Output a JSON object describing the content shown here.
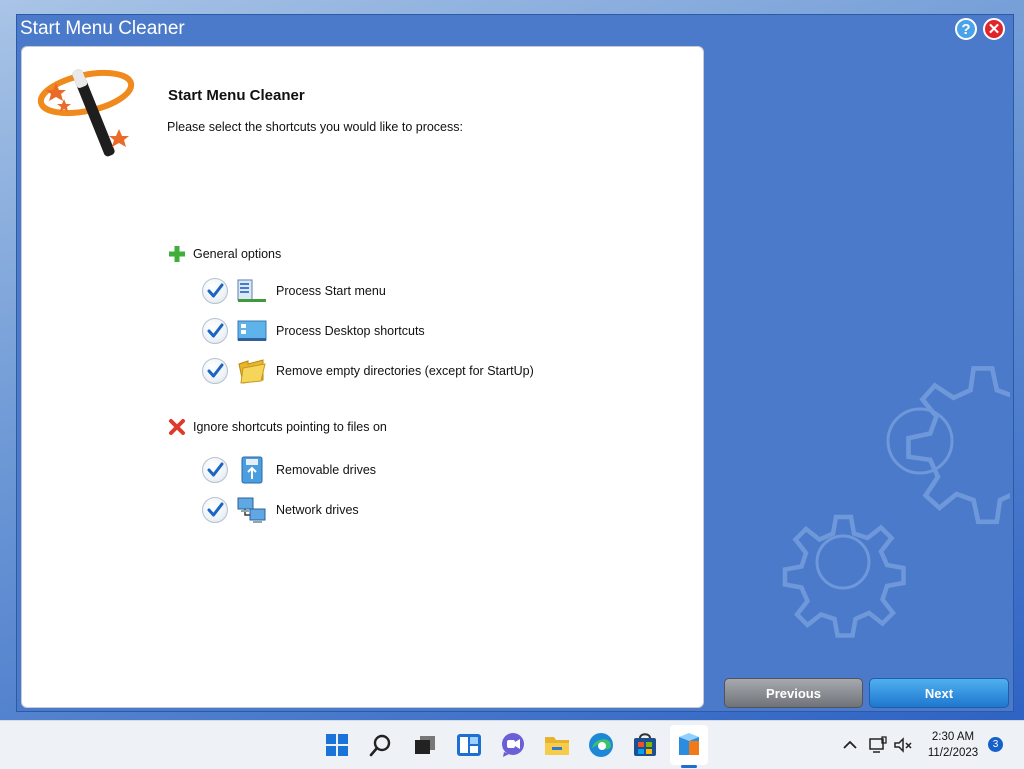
{
  "window": {
    "title": "Start Menu Cleaner",
    "help_label": "?",
    "close_label": "✕"
  },
  "panel": {
    "heading": "Start Menu Cleaner",
    "subtitle": "Please select the shortcuts you would like to process:"
  },
  "general": {
    "label": "General options",
    "icon": "plus-icon",
    "options": [
      {
        "label": "Process Start menu",
        "checked": true,
        "icon": "start-menu-icon"
      },
      {
        "label": "Process Desktop shortcuts",
        "checked": true,
        "icon": "desktop-icon"
      },
      {
        "label": "Remove empty directories (except for StartUp)",
        "checked": true,
        "icon": "folder-icon"
      }
    ]
  },
  "ignore": {
    "label": "Ignore shortcuts pointing to files on",
    "icon": "x-icon",
    "options": [
      {
        "label": "Removable drives",
        "checked": true,
        "icon": "usb-drive-icon"
      },
      {
        "label": "Network drives",
        "checked": true,
        "icon": "network-drives-icon"
      }
    ]
  },
  "buttons": {
    "previous": "Previous",
    "next": "Next"
  },
  "taskbar": {
    "time": "2:30 AM",
    "date": "11/2/2023",
    "notification_count": "3",
    "icons": [
      "windows-start-icon",
      "search-icon",
      "task-view-icon",
      "widgets-icon",
      "chat-icon",
      "file-explorer-icon",
      "edge-icon",
      "store-icon",
      "app-cleaner-icon"
    ]
  },
  "colors": {
    "window_bg": "#4a7ac9",
    "next_button": "#2c8ae0",
    "previous_button": "#8a8d92",
    "close_button": "#e0242a"
  }
}
